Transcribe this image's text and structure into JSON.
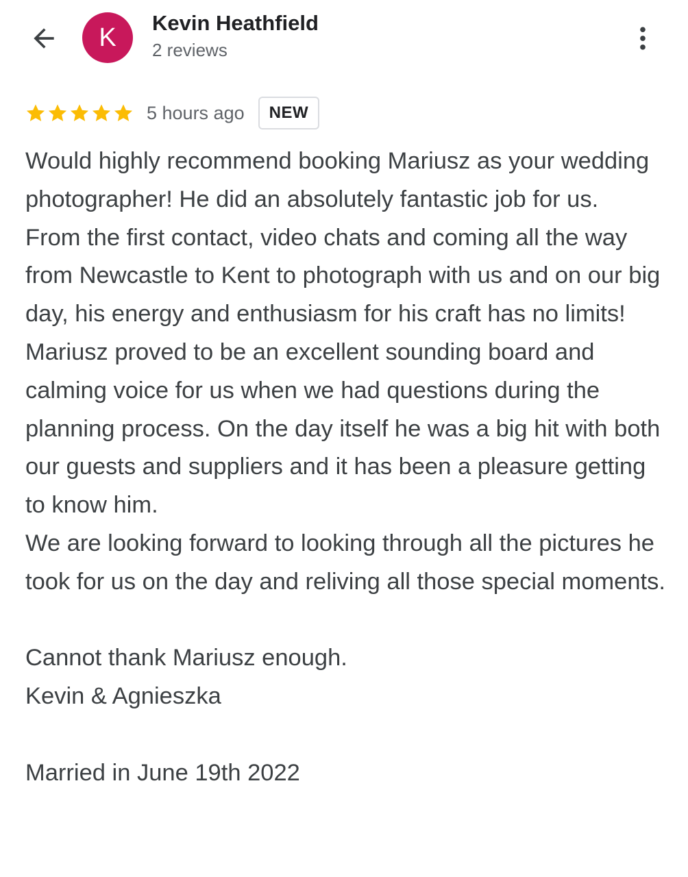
{
  "header": {
    "avatar_letter": "K",
    "author_name": "Kevin Heathfield",
    "author_meta": "2 reviews",
    "back_icon": "arrow-left-icon",
    "more_icon": "more-vertical-icon"
  },
  "rating": {
    "stars": 5,
    "max_stars": 5,
    "time_ago": "5 hours ago",
    "badge": "NEW"
  },
  "review": {
    "paragraph_1": "Would highly recommend booking Mariusz as your wedding photographer! He did an absolutely fantastic job for us.",
    "paragraph_2": "From the first contact, video chats and coming all the way from Newcastle to Kent to photograph with us and on our big day, his energy and enthusiasm for his craft has no limits! Mariusz proved to be an excellent sounding board and calming voice for us when we had questions during the planning process. On the day itself he was a big hit with both our guests and suppliers and it has been a pleasure getting to know him.",
    "paragraph_3": "We are looking forward to looking through all the pictures he took for us on the day and reliving all those special moments.",
    "paragraph_4": "Cannot thank Mariusz enough.",
    "paragraph_5": "Kevin & Agnieszka",
    "paragraph_6": "Married in June 19th 2022"
  },
  "colors": {
    "avatar_bg": "#c8185b",
    "star": "#fbbc04",
    "text": "#3c4043",
    "badge_border": "#dadce0"
  }
}
